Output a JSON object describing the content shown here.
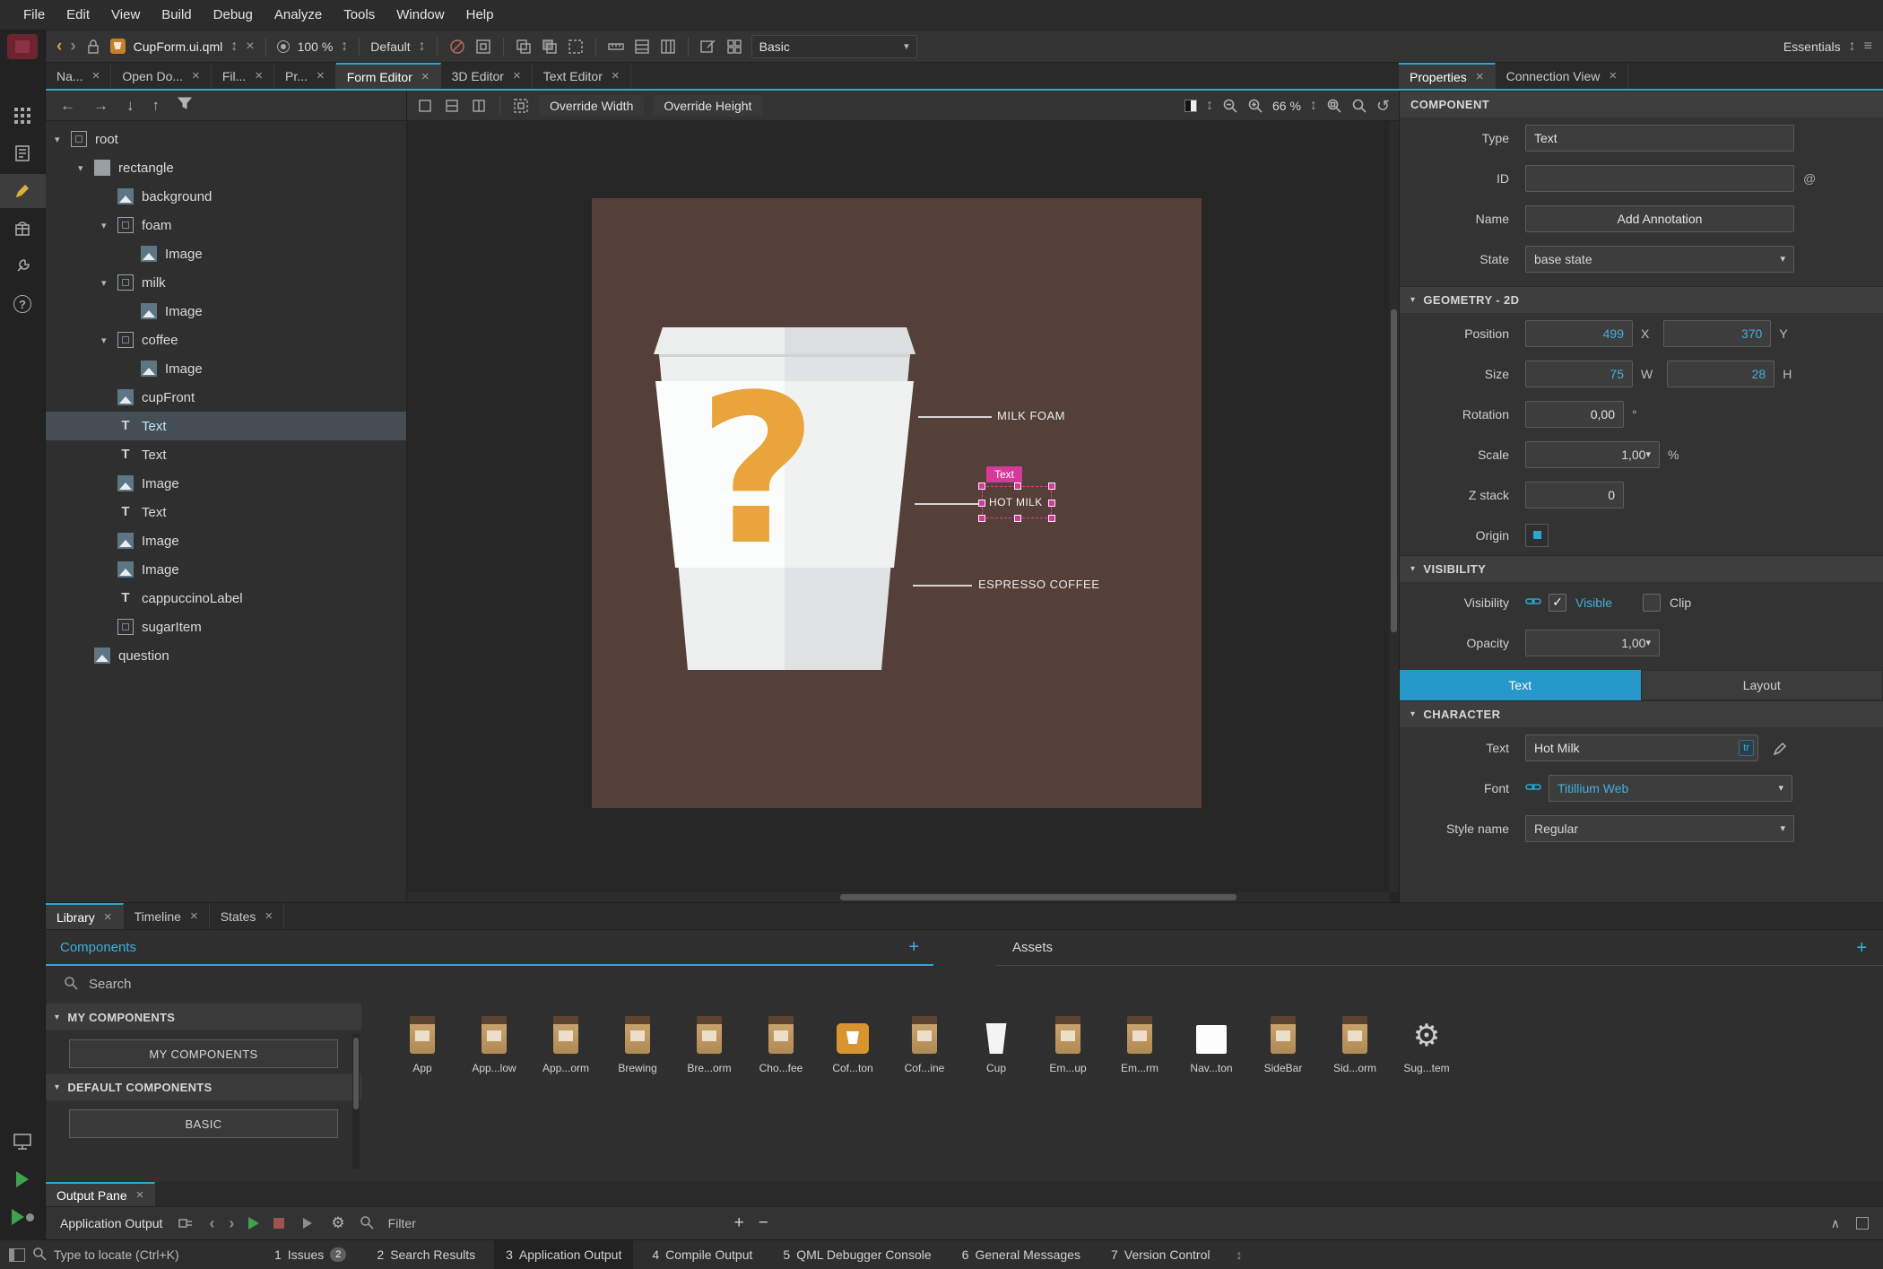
{
  "icons": {
    "close": "×",
    "triangle_down": "▾",
    "updown": "↕",
    "plus": "+",
    "minus": "−",
    "back": "‹",
    "forward": "›",
    "left_arrow": "←",
    "right_arrow": "→",
    "down_arrow": "↓",
    "up_arrow": "↑",
    "undo": "↺",
    "degree": "°",
    "percent": "%",
    "at": "@",
    "check": "✓",
    "gear": "⚙",
    "caret_up": "∧",
    "hamburger": "≡"
  },
  "colors": {
    "accent": "#2aa8d4",
    "magenta": "#d8389c",
    "canvas_brown": "#544039",
    "question_orange": "#e9a43c"
  },
  "menubar": {
    "items": [
      "File",
      "Edit",
      "View",
      "Build",
      "Debug",
      "Analyze",
      "Tools",
      "Window",
      "Help"
    ]
  },
  "toolbar": {
    "filename": "CupForm.ui.qml",
    "zoom_value": "100 %",
    "style_selector": "Default",
    "component_selector": "Basic",
    "kit_selector": "Essentials"
  },
  "tabbar": {
    "left_tabs": [
      {
        "label": "Na..."
      },
      {
        "label": "Open Do..."
      },
      {
        "label": "Fil..."
      },
      {
        "label": "Pr..."
      }
    ],
    "editor_tabs": [
      {
        "label": "Form Editor"
      },
      {
        "label": "3D Editor"
      },
      {
        "label": "Text Editor"
      }
    ],
    "right_tabs": [
      {
        "label": "Properties"
      },
      {
        "label": "Connection View"
      }
    ]
  },
  "navigator": {
    "items": [
      {
        "label": "root",
        "icon": "component-icon"
      },
      {
        "label": "rectangle",
        "icon": "rect-icon"
      },
      {
        "label": "background",
        "icon": "image-icon"
      },
      {
        "label": "foam",
        "icon": "component-icon"
      },
      {
        "label": "Image",
        "icon": "image-icon"
      },
      {
        "label": "milk",
        "icon": "component-icon"
      },
      {
        "label": "Image",
        "icon": "image-icon"
      },
      {
        "label": "coffee",
        "icon": "component-icon"
      },
      {
        "label": "Image",
        "icon": "image-icon"
      },
      {
        "label": "cupFront",
        "icon": "image-icon"
      },
      {
        "label": "Text",
        "icon": "text-icon"
      },
      {
        "label": "Text",
        "icon": "text-icon"
      },
      {
        "label": "Image",
        "icon": "image-icon"
      },
      {
        "label": "Text",
        "icon": "text-icon"
      },
      {
        "label": "Image",
        "icon": "image-icon"
      },
      {
        "label": "Image",
        "icon": "image-icon"
      },
      {
        "label": "cappuccinoLabel",
        "icon": "text-icon"
      },
      {
        "label": "sugarItem",
        "icon": "component-icon"
      },
      {
        "label": "question",
        "icon": "image-icon"
      }
    ]
  },
  "form_editor": {
    "override_width": "Override Width",
    "override_height": "Override Height",
    "zoom_value": "66 %",
    "canvas": {
      "milk_foam_label": "MILK FOAM",
      "hot_milk_label": "HOT MILK",
      "espresso_label": "ESPRESSO COFFEE",
      "selection_tag": "Text"
    }
  },
  "properties": {
    "component": {
      "title": "COMPONENT",
      "type_label": "Type",
      "type_value": "Text",
      "id_label": "ID",
      "id_value": "",
      "name_label": "Name",
      "name_button": "Add Annotation",
      "state_label": "State",
      "state_value": "base state"
    },
    "geometry": {
      "title": "GEOMETRY - 2D",
      "position_label": "Position",
      "x_value": "499",
      "x_suffix": "X",
      "y_value": "370",
      "y_suffix": "Y",
      "size_label": "Size",
      "w_value": "75",
      "w_suffix": "W",
      "h_value": "28",
      "h_suffix": "H",
      "rotation_label": "Rotation",
      "rotation_value": "0,00",
      "scale_label": "Scale",
      "scale_value": "1,00",
      "z_label": "Z stack",
      "z_value": "0",
      "origin_label": "Origin"
    },
    "visibility": {
      "title": "VISIBILITY",
      "visibility_label": "Visibility",
      "visible_label": "Visible",
      "clip_label": "Clip",
      "opacity_label": "Opacity",
      "opacity_value": "1,00"
    },
    "tabs": {
      "text": "Text",
      "layout": "Layout"
    },
    "character": {
      "title": "CHARACTER",
      "text_label": "Text",
      "text_value": "Hot Milk",
      "tr_badge": "tr",
      "font_label": "Font",
      "font_value": "Titillium Web",
      "style_label": "Style name",
      "style_value": "Regular"
    }
  },
  "library": {
    "tabs": [
      {
        "label": "Library"
      },
      {
        "label": "Timeline"
      },
      {
        "label": "States"
      }
    ],
    "components_header": "Components",
    "assets_header": "Assets",
    "search_placeholder": "Search",
    "my_components_section": "MY COMPONENTS",
    "my_components_button": "MY COMPONENTS",
    "default_components_section": "DEFAULT COMPONENTS",
    "basic_button": "BASIC",
    "components": [
      {
        "label": "App",
        "icon": "package"
      },
      {
        "label": "App...low",
        "icon": "package"
      },
      {
        "label": "App...orm",
        "icon": "package"
      },
      {
        "label": "Brewing",
        "icon": "package"
      },
      {
        "label": "Bre...orm",
        "icon": "package"
      },
      {
        "label": "Cho...fee",
        "icon": "package"
      },
      {
        "label": "Cof...ton",
        "icon": "button-orange"
      },
      {
        "label": "Cof...ine",
        "icon": "package"
      },
      {
        "label": "Cup",
        "icon": "cup-white"
      },
      {
        "label": "Em...up",
        "icon": "package"
      },
      {
        "label": "Em...rm",
        "icon": "package"
      },
      {
        "label": "Nav...ton",
        "icon": "square-white"
      },
      {
        "label": "SideBar",
        "icon": "package"
      },
      {
        "label": "Sid...orm",
        "icon": "package"
      },
      {
        "label": "Sug...tem",
        "icon": "gear"
      }
    ]
  },
  "output": {
    "pane_tab": "Output Pane",
    "channel": "Application Output",
    "filter_placeholder": "Filter"
  },
  "statusbar": {
    "locator_placeholder": "Type to locate (Ctrl+K)",
    "panes": [
      {
        "num": "1",
        "label": "Issues",
        "badge": "2"
      },
      {
        "num": "2",
        "label": "Search Results"
      },
      {
        "num": "3",
        "label": "Application Output"
      },
      {
        "num": "4",
        "label": "Compile Output"
      },
      {
        "num": "5",
        "label": "QML Debugger Console"
      },
      {
        "num": "6",
        "label": "General Messages"
      },
      {
        "num": "7",
        "label": "Version Control"
      }
    ]
  }
}
